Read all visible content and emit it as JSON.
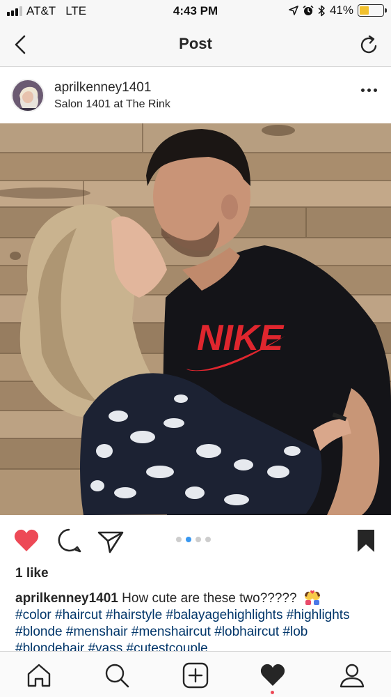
{
  "status_bar": {
    "carrier": "AT&T",
    "network": "LTE",
    "time": "4:43 PM",
    "battery": "41%",
    "battery_level": 0.41,
    "icons": [
      "location-arrow-icon",
      "alarm-icon",
      "bluetooth-icon"
    ]
  },
  "nav": {
    "title": "Post",
    "back_icon": "chevron-left-icon",
    "refresh_icon": "refresh-icon"
  },
  "post": {
    "username": "aprilkenney1401",
    "location": "Salon 1401 at The Rink",
    "more_icon": "more-horizontal-icon",
    "photo_description_icon": "photo",
    "carousel": {
      "count": 4,
      "active_index": 1
    },
    "liked": true,
    "likes": "1 like",
    "caption_user": "aprilkenney1401",
    "caption_text": "How cute are these two?????",
    "caption_emoji": "couple-kiss-emoji",
    "hashtags": "#color #haircut #hairstyle #balayagehighlights #highlights #blonde #menshair #menshaircut #lobhaircut #lob #blondehair #yass #cutestcouple",
    "shirt_text": "NIKE"
  },
  "actions": {
    "like_icon": "heart-filled-icon",
    "comment_icon": "comment-icon",
    "share_icon": "send-icon",
    "save_icon": "bookmark-filled-icon"
  },
  "tab_bar": {
    "items": [
      "home-icon",
      "search-icon",
      "add-post-icon",
      "activity-heart-icon",
      "profile-icon"
    ],
    "active": "activity-heart-icon"
  },
  "colors": {
    "like_red": "#ed4956",
    "hashtag_blue": "#003569",
    "carousel_active": "#3897f0",
    "battery_yellow": "#f2c12e"
  }
}
